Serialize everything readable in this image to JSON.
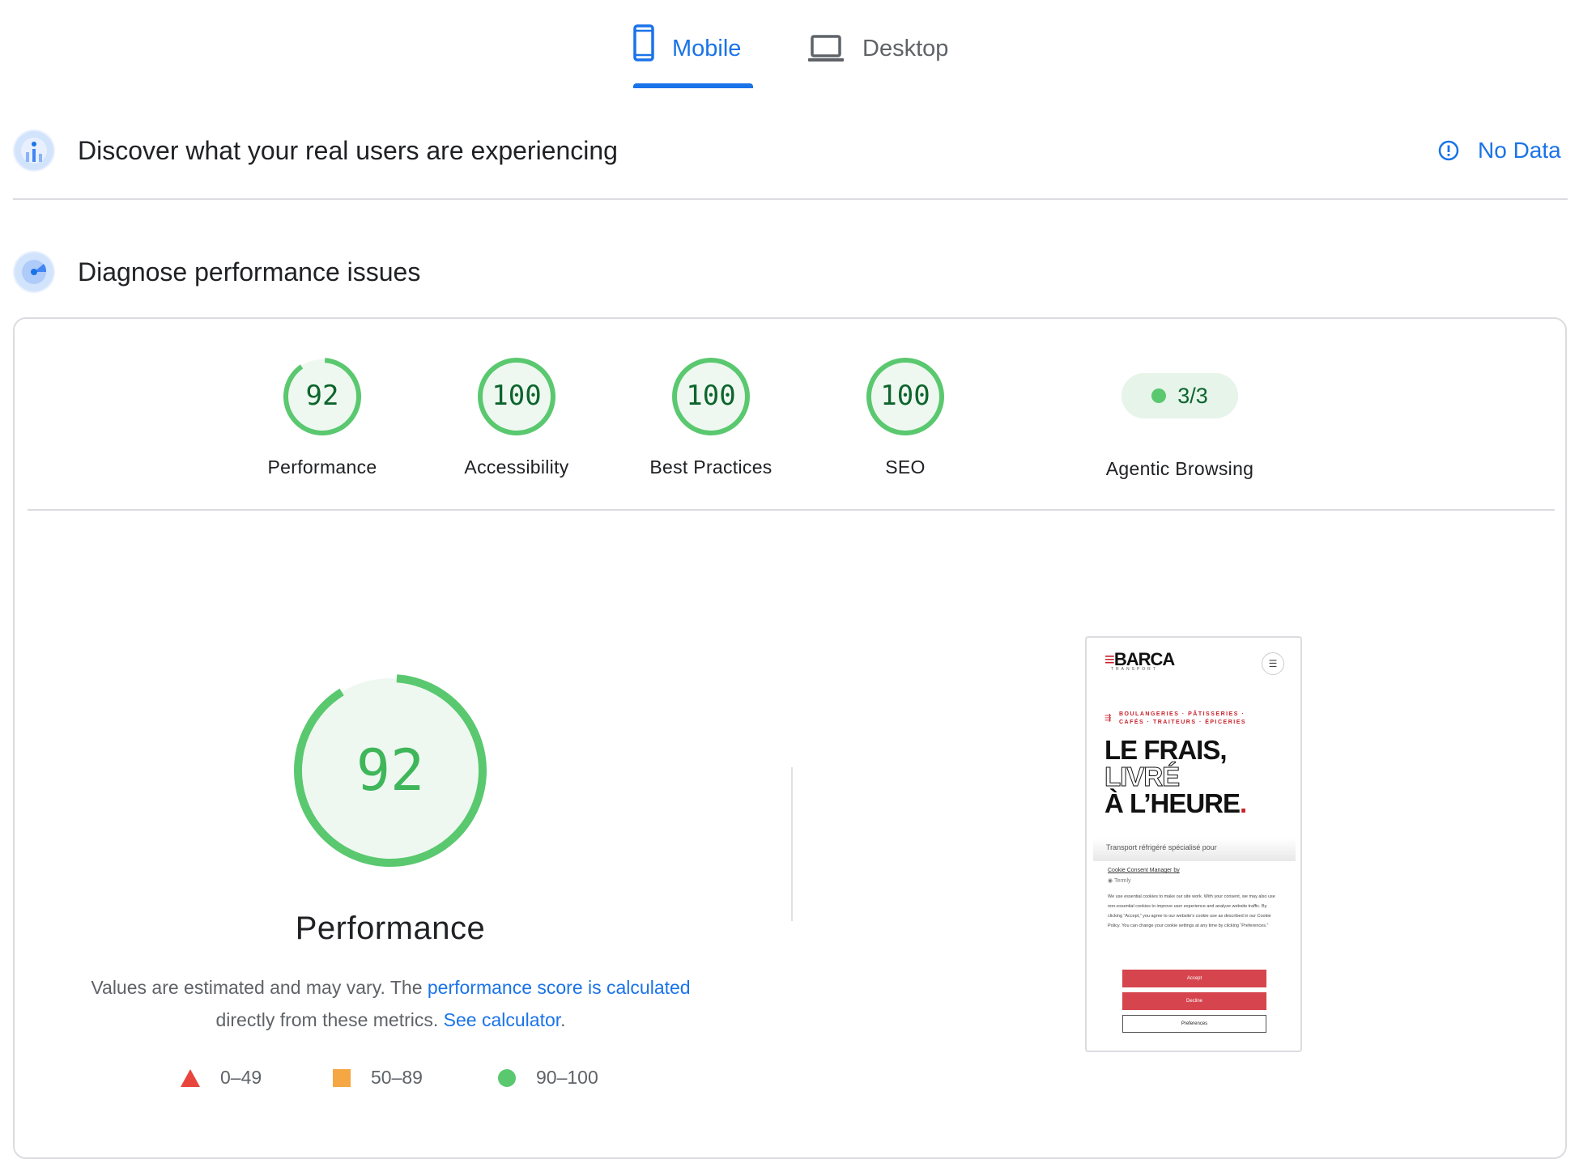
{
  "tabs": {
    "mobile": {
      "label": "Mobile",
      "icon": "phone-icon",
      "selected": true
    },
    "desktop": {
      "label": "Desktop",
      "icon": "laptop-icon",
      "selected": false
    }
  },
  "field_data": {
    "title": "Discover what your real users are experiencing",
    "icon": "users-chart-icon",
    "status_icon": "info-circle-icon",
    "status_label": "No Data"
  },
  "diagnose": {
    "title": "Diagnose performance issues",
    "icon": "radar-icon"
  },
  "scores": [
    {
      "label": "Performance",
      "value": "92",
      "fraction": 0.92
    },
    {
      "label": "Accessibility",
      "value": "100",
      "fraction": 1.0
    },
    {
      "label": "Best Practices",
      "value": "100",
      "fraction": 1.0
    },
    {
      "label": "SEO",
      "value": "100",
      "fraction": 1.0
    }
  ],
  "agentic": {
    "label": "Agentic Browsing",
    "value": "3/3"
  },
  "performance_detail": {
    "score": "92",
    "fraction": 0.92,
    "title": "Performance",
    "note_prefix": "Values are estimated and may vary. The ",
    "note_link1": "performance score is calculated",
    "note_middle": " directly from these metrics. ",
    "note_link2": "See calculator",
    "note_suffix": "."
  },
  "legend": [
    {
      "shape": "triangle",
      "color": "#e8453c",
      "range": "0–49"
    },
    {
      "shape": "square",
      "color": "#f4a742",
      "range": "50–89"
    },
    {
      "shape": "circle",
      "color": "#5ac86f",
      "range": "90–100"
    }
  ],
  "colors": {
    "accent": "#1a73e8",
    "good": "#5ac86f",
    "good_text": "#0d652d",
    "good_bg": "#e6f4ea"
  },
  "screenshot": {
    "logo": "BARCA",
    "logo_sub": "TRANSPORT",
    "tagline_1": "BOULANGERIES · PÂTISSERIES ·",
    "tagline_2": "CAFÉS · TRAITEURS · ÉPICERIES",
    "headline_1": "LE FRAIS,",
    "headline_2": "LIVRÉ",
    "headline_3": "À L’HEURE",
    "subtitle": "Transport réfrigéré spécialisé pour",
    "cookie_title": "Cookie Consent Manager",
    "cookie_title_suffix": " by",
    "cookie_by": "Termly",
    "cookie_text": "We use essential cookies to make our site work. With your consent, we may also use non-essential cookies to improve user experience and analyze website traffic. By clicking “Accept,” you agree to our website's cookie use as described in our Cookie Policy. You can change your cookie settings at any time by clicking “Preferences.”",
    "accept": "Accept",
    "decline": "Decline",
    "preferences": "Preferences"
  }
}
